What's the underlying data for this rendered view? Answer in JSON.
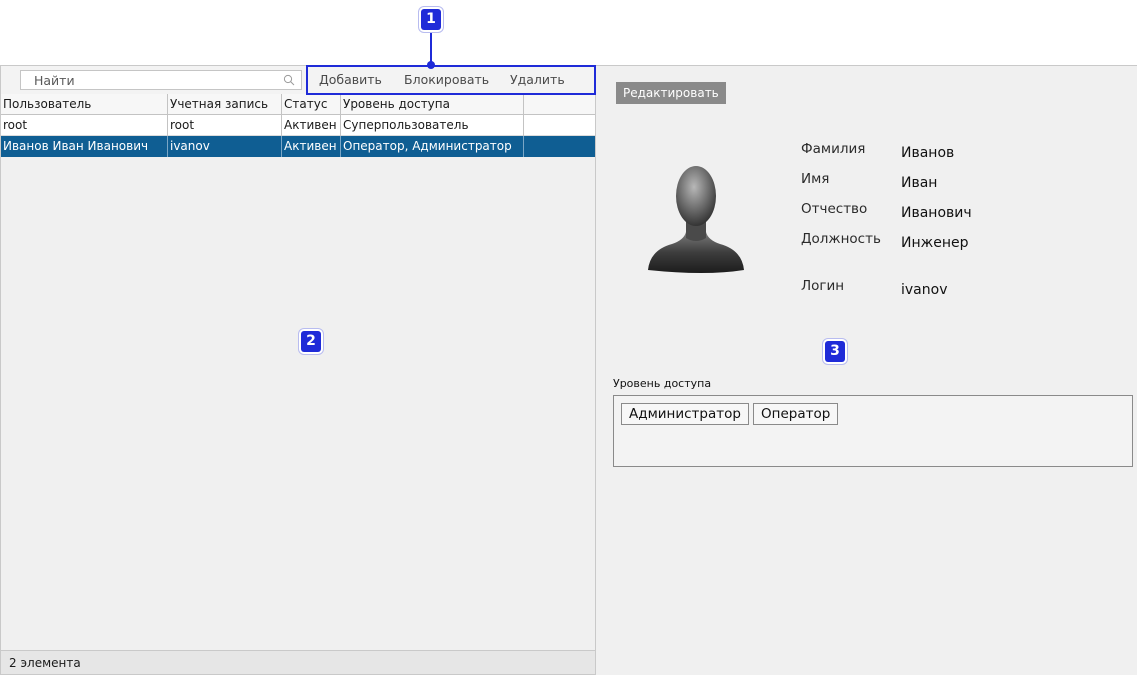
{
  "toolbar": {
    "search_placeholder": "Найти",
    "add_label": "Добавить",
    "block_label": "Блокировать",
    "delete_label": "Удалить"
  },
  "table": {
    "columns": [
      "Пользователь",
      "Учетная запись",
      "Статус",
      "Уровень доступа",
      ""
    ],
    "rows": [
      [
        "root",
        "root",
        "Активен",
        "Суперпользователь",
        ""
      ],
      [
        "Иванов Иван Иванович",
        "ivanov",
        "Активен",
        "Оператор, Администратор",
        ""
      ]
    ],
    "selected_row": 1
  },
  "status_bar": {
    "text": "2 элемента"
  },
  "detail": {
    "edit_label": "Редактировать",
    "fields": {
      "surname_label": "Фамилия",
      "surname_value": "Иванов",
      "name_label": "Имя",
      "name_value": "Иван",
      "patronymic_label": "Отчество",
      "patronymic_value": "Иванович",
      "position_label": "Должность",
      "position_value": "Инженер",
      "login_label": "Логин",
      "login_value": "ivanov"
    },
    "access_label": "Уровень доступа",
    "access_tags": [
      "Администратор",
      "Оператор"
    ]
  },
  "callouts": {
    "one": "1",
    "two": "2",
    "three": "3"
  },
  "colors": {
    "accent": "#1f2bd8",
    "selection": "#0f5e93",
    "edit_button": "#8a8a8a"
  }
}
